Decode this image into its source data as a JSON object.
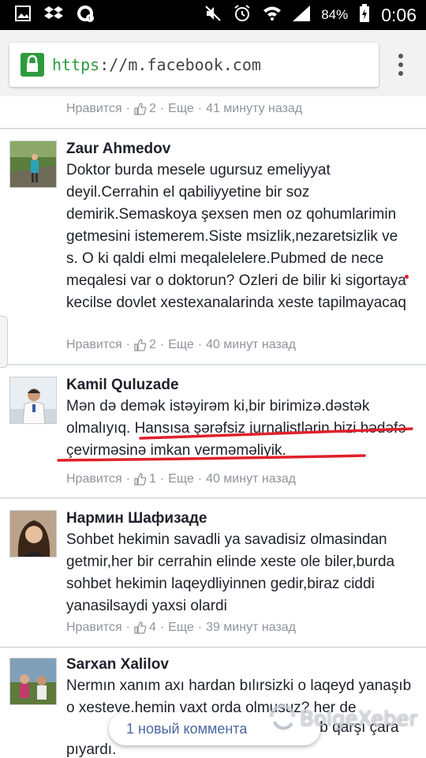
{
  "status_bar": {
    "battery_percent": "84%",
    "time": "0:06"
  },
  "browser": {
    "url_scheme": "https",
    "url_rest": "://m.facebook.com"
  },
  "meta_labels": {
    "like": "Нравится",
    "more": "Еще"
  },
  "prev_comment_meta": {
    "likes": "2",
    "time": "41 минуту назад"
  },
  "comments": [
    {
      "author": "Zaur Ahmedov",
      "text": "Doktor burda mesele ugursuz emeliyyat deyil.Cerrahin el qabiliyyetine bir soz demirik.Semaskoya şexsen men oz qohumlarimin getmesini istemerem.Siste msizlik,nezaretsizlik ve s. O ki qaldi elmi meqalelelere.Pubmed de nece meqalesi var o doktorun? Ozleri de bilir ki sigortaya kecilse dovlet xestexanalarinda xeste tapilmayacaq",
      "likes": "2",
      "time": "40 минут назад"
    },
    {
      "author": "Kamil Quluzade",
      "text": "Mən də demək istəyirəm ki,bir birimizə.dəstək olmalıyıq. Hansısa şərəfsiz jurnalistlərin bizi hədəfə çevirməsinə imkan verməməliyik.",
      "likes": "1",
      "time": "40 минут назад"
    },
    {
      "author": "Нармин Шафизаде",
      "text": "Sohbet hekimin savadli ya savadisiz olmasindan getmir,her bir cerrahin elinde xeste ole biler,burda sohbet hekimin laqeydliyinnen gedir,biraz ciddi yanasilsaydi yaxsi olardi",
      "likes": "4",
      "time": "39 минут назад"
    },
    {
      "author": "Sarxan Xalilov",
      "text": "Nermın xanım axı hardan bılırsizki o laqeyd yanaşıb o xesteve.hemin vaxt orda olmusuz? her de",
      "text_tail": "ıb qarşı çara",
      "text_line4": "pıyardı."
    }
  ],
  "new_comment_pill": "1 новый коммента",
  "watermark": "BolgeXeber",
  "colors": {
    "link_blue": "#4b67a1",
    "meta_gray": "#90949c",
    "underline_red": "#e0202b",
    "secure_green": "#2e9b3e"
  }
}
